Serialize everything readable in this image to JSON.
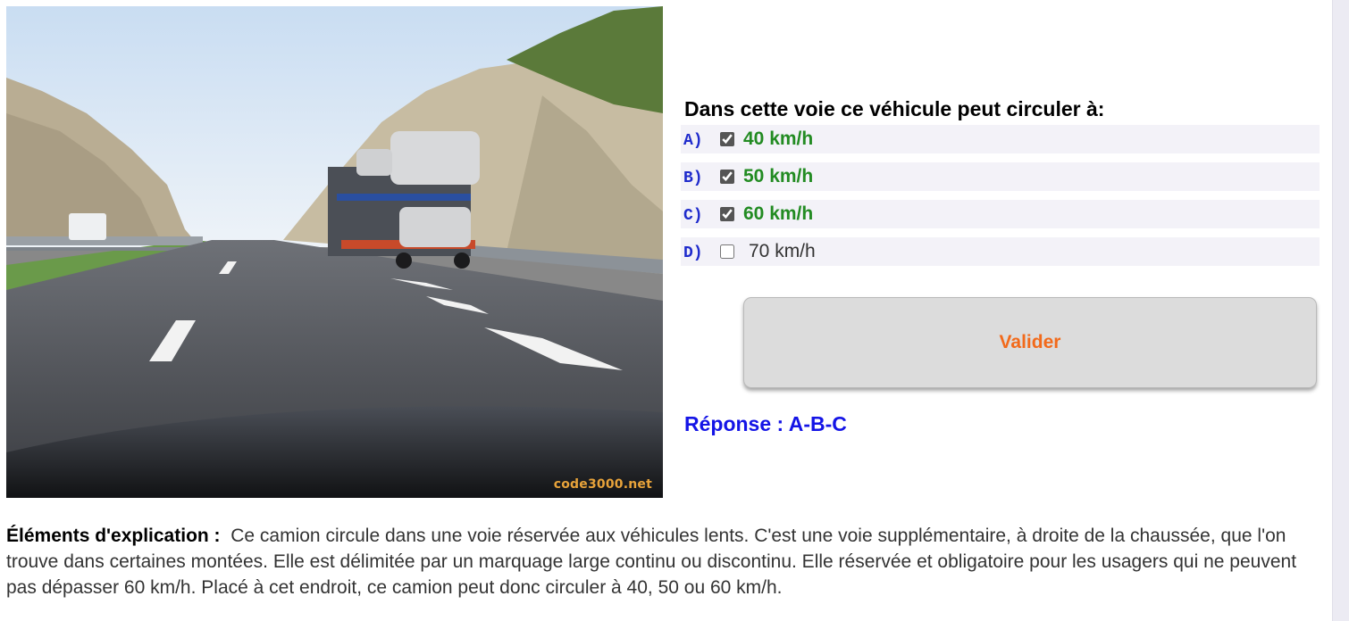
{
  "photo": {
    "watermark": "code3000.net"
  },
  "question": {
    "title": "Dans cette voie ce véhicule peut circuler à:",
    "answers": [
      {
        "letter": "A)",
        "text": "40 km/h",
        "checked": true,
        "correct": true
      },
      {
        "letter": "B)",
        "text": "50 km/h",
        "checked": true,
        "correct": true
      },
      {
        "letter": "C)",
        "text": "60 km/h",
        "checked": true,
        "correct": true
      },
      {
        "letter": "D)",
        "text": "70 km/h",
        "checked": false,
        "correct": false
      }
    ]
  },
  "validate": {
    "label": "Valider"
  },
  "response": {
    "text": "Réponse : A-B-C"
  },
  "explanation": {
    "label": "Éléments d'explication :",
    "text": "Ce camion circule dans une voie réservée aux véhicules lents. C'est une voie supplémentaire, à droite de la chaussée, que l'on trouve dans certaines montées. Elle est délimitée par un marquage large continu ou discontinu. Elle réservée et obligatoire pour les usagers qui ne peuvent pas dépasser 60 km/h. Placé à cet endroit, ce camion peut donc circuler à 40, 50 ou 60 km/h."
  },
  "colors": {
    "correct_answer": "#228b22",
    "answer_letter": "#1f2bcc",
    "validate_text": "#f26a1b",
    "response_text": "#1414e6"
  }
}
